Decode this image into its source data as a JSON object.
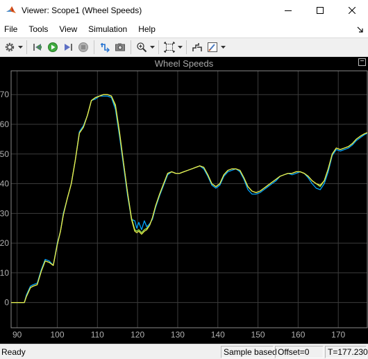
{
  "window": {
    "title": "Viewer: Scope1 (Wheel Speeds)",
    "icon": "matlab-logo-icon",
    "controls": [
      "minimize-icon",
      "maximize-icon",
      "close-icon"
    ]
  },
  "menu": {
    "items": [
      "File",
      "Tools",
      "View",
      "Simulation",
      "Help"
    ]
  },
  "toolbar": {
    "buttons": [
      "settings-gear-icon",
      "step-back-icon",
      "run-icon",
      "step-forward-icon",
      "stop-icon",
      "highlight-signal-icon",
      "snapshot-camera-icon",
      "zoom-in-icon",
      "autoscale-icon",
      "cursor-measurements-icon",
      "style-brush-icon"
    ]
  },
  "scope": {
    "title": "Wheel Speeds",
    "background": "#000000",
    "axis_color": "#8a8a8a",
    "grid_color": "#3c3c3c"
  },
  "chart_data": {
    "type": "line",
    "title": "Wheel Speeds",
    "xlabel": "",
    "ylabel": "",
    "xlim": [
      88.5,
      177.23
    ],
    "ylim": [
      -8.5,
      78
    ],
    "xticks": [
      90,
      100,
      110,
      120,
      130,
      140,
      150,
      160,
      170
    ],
    "yticks": [
      0,
      10,
      20,
      30,
      40,
      50,
      60,
      70
    ],
    "grid": true,
    "legend": "none",
    "series": [
      {
        "color": "#00a6ff",
        "x": [
          88.5,
          91.0,
          91.8,
          92.3,
          93.3,
          94.0,
          95.0,
          96.0,
          97.0,
          98.0,
          99.0,
          100.0,
          100.8,
          101.5,
          102.5,
          103.5,
          104.5,
          105.5,
          106.5,
          107.5,
          108.5,
          109.5,
          110.5,
          111.5,
          112.5,
          113.5,
          114.5,
          115.5,
          116.5,
          117.5,
          118.5,
          119.3,
          119.8,
          120.3,
          121.0,
          121.7,
          122.3,
          123.0,
          123.7,
          124.5,
          125.5,
          126.5,
          127.5,
          128.5,
          129.5,
          130.5,
          131.5,
          132.5,
          133.5,
          134.5,
          135.5,
          136.5,
          137.5,
          138.5,
          139.5,
          140.5,
          141.5,
          142.5,
          143.5,
          144.5,
          145.5,
          146.5,
          147.5,
          148.5,
          149.5,
          150.5,
          151.5,
          152.5,
          153.5,
          154.5,
          155.5,
          156.5,
          157.5,
          158.5,
          159.5,
          160.5,
          161.5,
          162.5,
          163.5,
          164.5,
          165.5,
          166.5,
          167.5,
          168.5,
          169.5,
          170.5,
          171.5,
          172.5,
          173.5,
          174.5,
          175.5,
          176.5,
          177.23
        ],
        "y": [
          0,
          0,
          0,
          2.5,
          5.5,
          6.0,
          6.5,
          11.0,
          14.5,
          14.0,
          12.5,
          20.0,
          24.0,
          30.0,
          35.0,
          40.0,
          48.0,
          57.5,
          59.5,
          63.0,
          68.0,
          68.5,
          69.5,
          69.5,
          69.5,
          69.0,
          65.0,
          56.0,
          46.0,
          36.0,
          28.0,
          27.5,
          25.0,
          27.0,
          24.5,
          27.5,
          25.5,
          26.5,
          28.0,
          32.0,
          36.0,
          39.5,
          43.0,
          44.0,
          43.5,
          43.5,
          44.0,
          44.5,
          45.0,
          45.5,
          46.0,
          45.0,
          42.5,
          39.5,
          38.5,
          39.5,
          42.5,
          44.0,
          44.5,
          45.0,
          44.0,
          41.5,
          38.0,
          36.5,
          36.5,
          37.0,
          38.0,
          39.0,
          40.0,
          41.0,
          42.5,
          43.0,
          43.5,
          43.0,
          43.5,
          44.0,
          43.5,
          42.0,
          40.0,
          38.5,
          38.0,
          40.0,
          44.0,
          49.5,
          51.5,
          51.0,
          51.5,
          52.0,
          53.0,
          54.5,
          55.5,
          56.5,
          57.0
        ]
      },
      {
        "color": "#9ae34a",
        "x": [
          88.5,
          91.0,
          91.8,
          92.3,
          93.3,
          94.0,
          95.0,
          96.0,
          97.0,
          98.0,
          99.0,
          100.0,
          100.8,
          101.5,
          102.5,
          103.5,
          104.5,
          105.5,
          106.5,
          107.5,
          108.5,
          109.5,
          110.5,
          111.5,
          112.5,
          113.5,
          114.5,
          115.5,
          116.5,
          117.5,
          118.5,
          119.3,
          119.8,
          120.3,
          121.0,
          121.7,
          122.3,
          123.0,
          123.7,
          124.5,
          125.5,
          126.5,
          127.5,
          128.5,
          129.5,
          130.5,
          131.5,
          132.5,
          133.5,
          134.5,
          135.5,
          136.5,
          137.5,
          138.5,
          139.5,
          140.5,
          141.5,
          142.5,
          143.5,
          144.5,
          145.5,
          146.5,
          147.5,
          148.5,
          149.5,
          150.5,
          151.5,
          152.5,
          153.5,
          154.5,
          155.5,
          156.5,
          157.5,
          158.5,
          159.5,
          160.5,
          161.5,
          162.5,
          163.5,
          164.5,
          165.5,
          166.5,
          167.5,
          168.5,
          169.5,
          170.5,
          171.5,
          172.5,
          173.5,
          174.5,
          175.5,
          176.5,
          177.23
        ],
        "y": [
          0,
          0,
          0,
          2.0,
          5.0,
          5.5,
          6.0,
          10.5,
          14.0,
          13.5,
          12.5,
          19.5,
          24.0,
          29.5,
          35.0,
          40.0,
          48.0,
          57.0,
          59.0,
          63.0,
          68.0,
          69.0,
          69.5,
          70.0,
          70.0,
          69.5,
          66.0,
          57.0,
          47.0,
          37.0,
          28.5,
          24.5,
          24.0,
          24.5,
          23.5,
          24.5,
          25.0,
          26.0,
          28.5,
          32.5,
          36.5,
          40.0,
          43.5,
          44.0,
          43.5,
          43.5,
          44.0,
          44.5,
          45.0,
          45.5,
          46.0,
          45.5,
          43.0,
          40.0,
          39.0,
          40.0,
          43.0,
          44.5,
          45.0,
          45.0,
          44.5,
          42.0,
          39.0,
          37.5,
          37.0,
          37.5,
          38.5,
          39.5,
          40.5,
          41.5,
          42.5,
          43.0,
          43.5,
          43.5,
          44.0,
          44.0,
          43.5,
          42.5,
          41.0,
          40.0,
          39.0,
          41.0,
          45.0,
          50.0,
          52.0,
          51.5,
          52.0,
          52.5,
          53.5,
          55.0,
          56.0,
          56.8,
          57.2
        ]
      },
      {
        "color": "#e8e84a",
        "x": [
          88.5,
          91.0,
          91.8,
          92.3,
          93.3,
          94.0,
          95.0,
          96.0,
          97.0,
          98.0,
          99.0,
          100.0,
          100.8,
          101.5,
          102.5,
          103.5,
          104.5,
          105.5,
          106.5,
          107.5,
          108.5,
          109.5,
          110.5,
          111.5,
          112.5,
          113.5,
          114.5,
          115.5,
          116.5,
          117.5,
          118.5,
          119.3,
          119.8,
          120.3,
          121.0,
          121.7,
          122.3,
          123.0,
          123.7,
          124.5,
          125.5,
          126.5,
          127.5,
          128.5,
          129.5,
          130.5,
          131.5,
          132.5,
          133.5,
          134.5,
          135.5,
          136.5,
          137.5,
          138.5,
          139.5,
          140.5,
          141.5,
          142.5,
          143.5,
          144.5,
          145.5,
          146.5,
          147.5,
          148.5,
          149.5,
          150.5,
          151.5,
          152.5,
          153.5,
          154.5,
          155.5,
          156.5,
          157.5,
          158.5,
          159.5,
          160.5,
          161.5,
          162.5,
          163.5,
          164.5,
          165.5,
          166.5,
          167.5,
          168.5,
          169.5,
          170.5,
          171.5,
          172.5,
          173.5,
          174.5,
          175.5,
          176.5,
          177.23
        ],
        "y": [
          0,
          0,
          0,
          2.0,
          5.0,
          5.5,
          6.0,
          10.5,
          14.0,
          13.5,
          12.5,
          19.5,
          24.0,
          29.5,
          35.0,
          40.0,
          48.0,
          57.0,
          59.0,
          63.0,
          68.0,
          69.0,
          69.5,
          70.0,
          70.0,
          69.5,
          66.5,
          57.5,
          47.0,
          37.0,
          28.0,
          24.0,
          23.5,
          24.0,
          23.0,
          24.0,
          24.5,
          26.0,
          28.5,
          32.5,
          36.5,
          40.0,
          43.5,
          44.0,
          43.5,
          43.5,
          44.0,
          44.5,
          45.0,
          45.5,
          46.0,
          45.5,
          43.0,
          40.0,
          39.0,
          40.0,
          43.0,
          44.5,
          45.0,
          45.0,
          44.5,
          42.0,
          39.0,
          37.5,
          37.0,
          37.5,
          38.5,
          39.5,
          40.5,
          41.5,
          42.5,
          43.0,
          43.5,
          43.5,
          44.0,
          44.0,
          43.5,
          42.5,
          41.0,
          40.0,
          39.5,
          41.0,
          45.0,
          50.0,
          52.0,
          51.5,
          52.0,
          52.5,
          53.5,
          55.0,
          56.0,
          56.8,
          57.2
        ]
      }
    ]
  },
  "status": {
    "ready": "Ready",
    "sample_mode": "Sample based",
    "offset": "Offset=0",
    "time": "T=177.230"
  }
}
